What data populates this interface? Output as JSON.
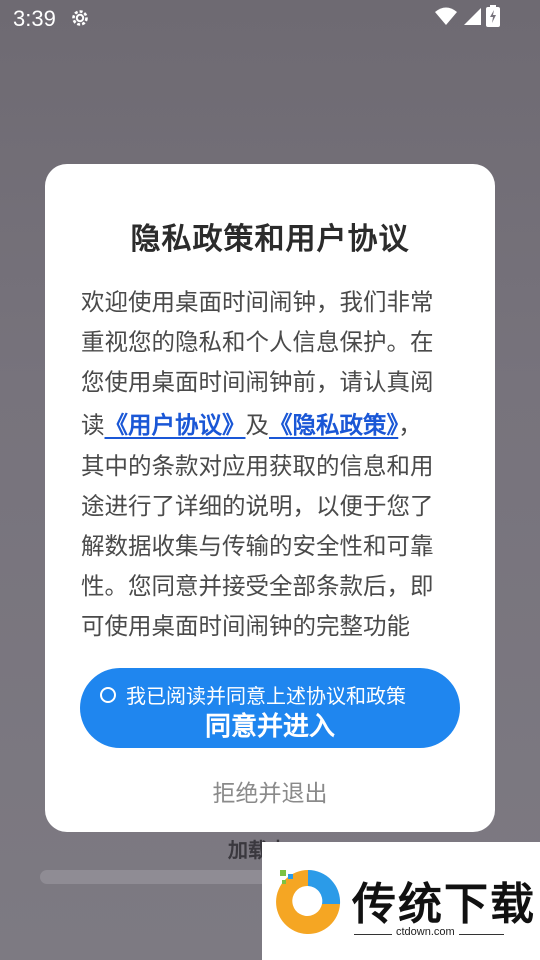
{
  "status_bar": {
    "time": "3:39",
    "icons": [
      "gear-icon",
      "wifi-icon",
      "cellular-signal-icon",
      "battery-charging-icon"
    ]
  },
  "background": {
    "loading_text": "加载中",
    "colors": {
      "backdrop": "#77737c",
      "progress_track": "#8f8c94"
    }
  },
  "dialog": {
    "title": "隐私政策和用户协议",
    "body": {
      "line1": "欢迎使用桌面时间闹钟，我们非常",
      "line2": "重视您的隐私和个人信息保护。在",
      "line3": "您使用桌面时间闹钟前，请认真阅",
      "line4_prefix": "读",
      "user_agreement_link": "《用户协议》",
      "and_text": "及",
      "privacy_policy_link": "《隐私政策》",
      "line4_suffix": "，",
      "line5": "其中的条款对应用获取的信息和用",
      "line6": "途进行了详细的说明，以便于您了",
      "line7": "解数据收集与传输的安全性和可靠",
      "line8": "性。您同意并接受全部条款后，即",
      "line9": "可使用桌面时间闹钟的完整功能"
    },
    "agree_checkbox_label": "我已阅读并同意上述协议和政策",
    "agree_checked": false,
    "agree_button_label": "同意并进入",
    "decline_label": "拒绝并退出",
    "colors": {
      "primary": "#1f86ef",
      "link": "#1a57d6",
      "title": "#2b2b2b",
      "body": "#4a4a4a",
      "decline": "#8a8a8a"
    }
  },
  "watermark": {
    "brand_text": "传统下载",
    "domain": "ctdown.com"
  }
}
